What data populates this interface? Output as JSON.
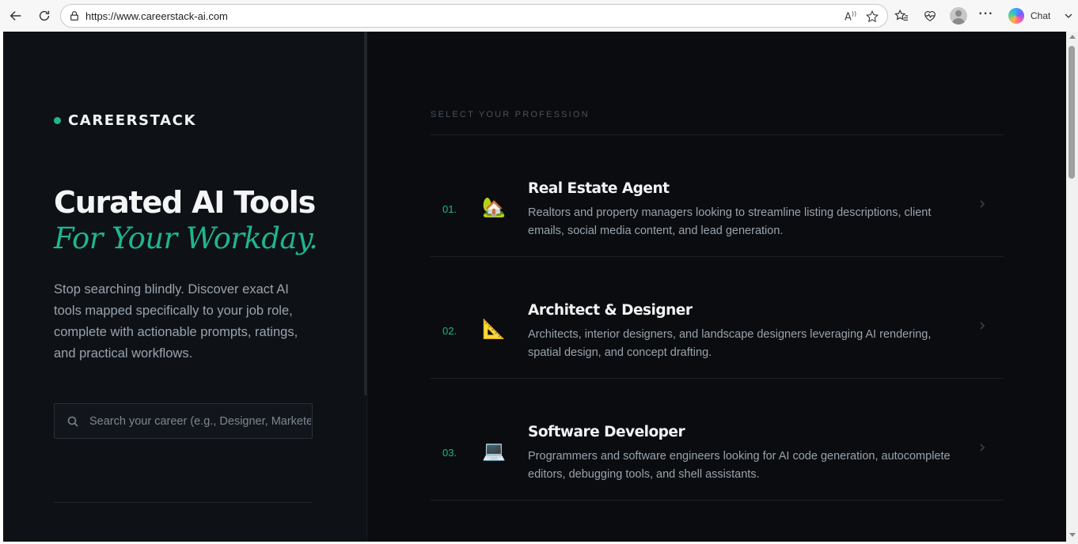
{
  "browser": {
    "url": "https://www.careerstack-ai.com",
    "chat_label": "Chat",
    "icons": [
      "back-icon",
      "refresh-icon",
      "lock-icon",
      "read-aloud-icon",
      "favorite-star-icon",
      "favorites-icon",
      "browser-essentials-icon",
      "profile-avatar-icon",
      "more-icon",
      "copilot-icon",
      "chevron-down-icon"
    ]
  },
  "brand": {
    "name": "CAREERSTACK",
    "accent_color": "#1fb58f"
  },
  "hero": {
    "title": "Curated AI Tools",
    "subtitle": "For Your Workday.",
    "description": "Stop searching blindly. Discover exact AI tools mapped specifically to your job role, complete with actionable prompts, ratings, and practical workflows."
  },
  "search": {
    "placeholder": "Search your career (e.g., Designer, Marketer...)",
    "value": ""
  },
  "professions": {
    "label": "SELECT YOUR PROFESSION",
    "items": [
      {
        "number": "01.",
        "icon": "🏡",
        "icon_name": "house-icon",
        "title": "Real Estate Agent",
        "description": "Realtors and property managers looking to streamline listing descriptions, client emails, social media content, and lead generation."
      },
      {
        "number": "02.",
        "icon": "📐",
        "icon_name": "triangle-ruler-icon",
        "title": "Architect & Designer",
        "description": "Architects, interior designers, and landscape designers leveraging AI rendering, spatial design, and concept drafting."
      },
      {
        "number": "03.",
        "icon": "💻",
        "icon_name": "laptop-icon",
        "title": "Software Developer",
        "description": "Programmers and software engineers looking for AI code generation, autocomplete editors, debugging tools, and shell assistants."
      }
    ]
  }
}
